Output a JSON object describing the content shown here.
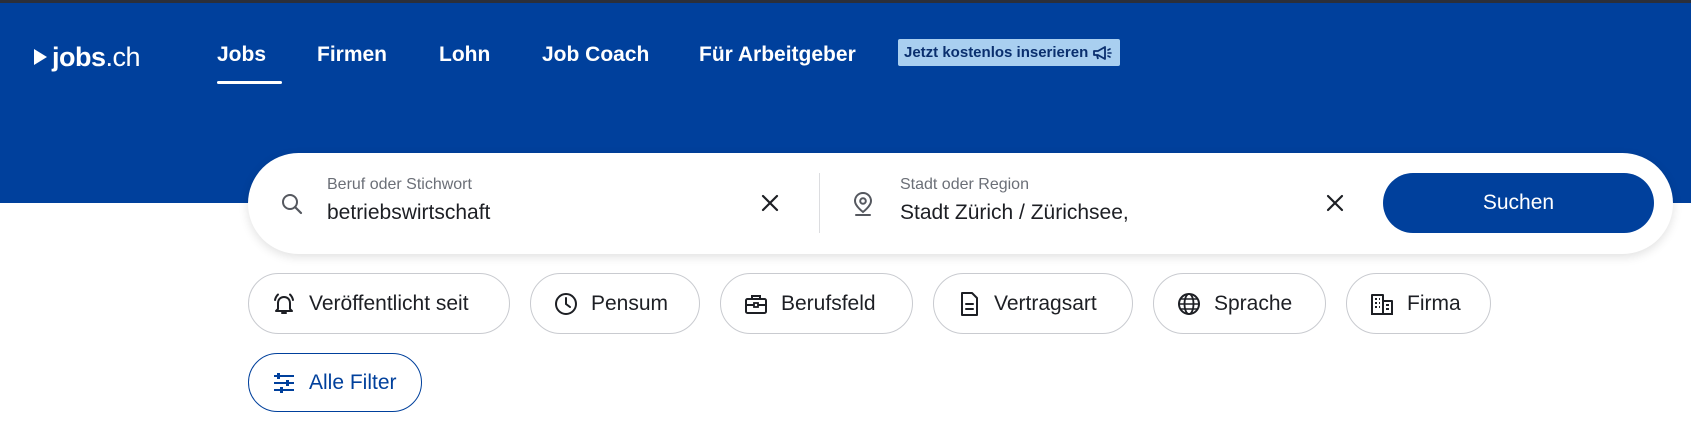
{
  "logo": {
    "brand": "jobs",
    "tld": ".ch"
  },
  "nav": {
    "items": [
      {
        "label": "Jobs",
        "active": true
      },
      {
        "label": "Firmen"
      },
      {
        "label": "Lohn"
      },
      {
        "label": "Job Coach"
      },
      {
        "label": "Für Arbeitgeber"
      }
    ],
    "badge": "Jetzt kostenlos inserieren"
  },
  "search": {
    "keyword": {
      "label": "Beruf oder Stichwort",
      "value": "betriebswirtschaft"
    },
    "location": {
      "label": "Stadt oder Region",
      "value": "Stadt Zürich / Zürichsee,"
    },
    "submit": "Suchen"
  },
  "filters": {
    "chips": [
      {
        "label": "Veröffentlicht seit",
        "icon": "bell-icon"
      },
      {
        "label": "Pensum",
        "icon": "clock-icon"
      },
      {
        "label": "Berufsfeld",
        "icon": "briefcase-icon"
      },
      {
        "label": "Vertragsart",
        "icon": "document-icon"
      },
      {
        "label": "Sprache",
        "icon": "globe-icon"
      },
      {
        "label": "Firma",
        "icon": "building-icon"
      }
    ],
    "all_filters": {
      "label": "Alle Filter",
      "icon": "sliders-icon"
    }
  },
  "colors": {
    "brand_blue": "#00409c",
    "badge_bg": "#a9cff0",
    "chip_border": "#c9cbd0"
  }
}
